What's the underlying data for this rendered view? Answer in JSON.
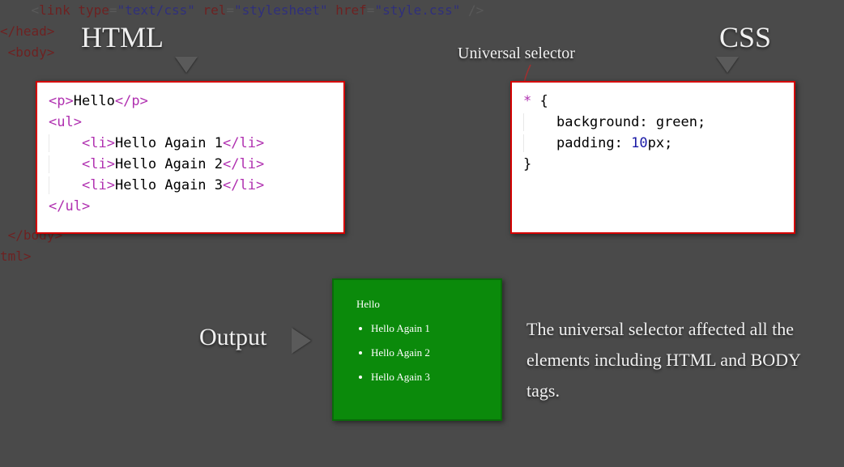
{
  "labels": {
    "html": "HTML",
    "css": "CSS",
    "universal": "Universal selector",
    "output": "Output",
    "explain": "The universal selector affected all the elements including HTML and BODY tags."
  },
  "bg_code": {
    "l1_pre": "    <",
    "l1_tag": "link",
    "l1_sp": " ",
    "l1_a1n": "type",
    "l1_eq": "=",
    "l1_a1v": "\"text/css\"",
    "l1_a2n": "rel",
    "l1_a2v": "\"stylesheet\"",
    "l1_a3n": "href",
    "l1_a3v": "\"style.css\"",
    "l1_end": " />",
    "l2": "</head>",
    "l3": "",
    "l4": "<body>",
    "l5": "",
    "l6": "</body>",
    "l7": "",
    "l8": "tml>"
  },
  "html_code": {
    "p_open": "<p>",
    "p_text": "Hello",
    "p_close": "</p>",
    "ul_open": "<ul>",
    "li_open": "<li>",
    "li_close": "</li>",
    "li1": "Hello Again 1",
    "li2": "Hello Again 2",
    "li3": "Hello Again 3",
    "ul_close": "</ul>"
  },
  "css_code": {
    "selector": "*",
    "brace_open": "{",
    "prop1": "background: ",
    "val1": "green",
    "semicolon1": ";",
    "prop2": "padding: ",
    "num2": "10",
    "unit2": "px",
    "semicolon2": ";",
    "brace_close": "}"
  },
  "output": {
    "p": "Hello",
    "li1": "Hello Again 1",
    "li2": "Hello Again 2",
    "li3": "Hello Again 3"
  }
}
